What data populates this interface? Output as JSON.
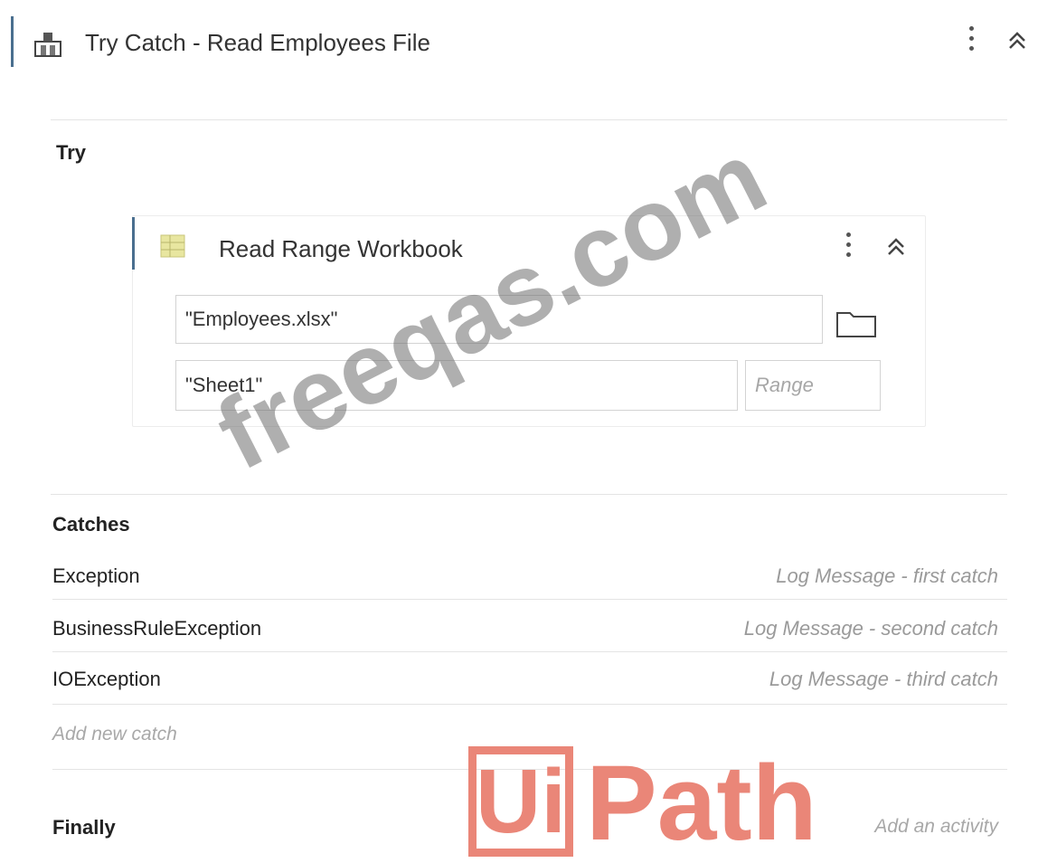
{
  "header": {
    "title": "Try Catch - Read Employees File",
    "icon": "try-catch-icon"
  },
  "try": {
    "label": "Try",
    "activity": {
      "title": "Read Range Workbook",
      "icon": "excel-workbook-icon",
      "workbook_path": "\"Employees.xlsx\"",
      "sheet_name": "\"Sheet1\"",
      "range_placeholder": "Range",
      "browse_icon": "folder-icon"
    }
  },
  "catches": {
    "label": "Catches",
    "items": [
      {
        "type": "Exception",
        "action": "Log Message - first catch"
      },
      {
        "type": "BusinessRuleException",
        "action": "Log Message - second catch"
      },
      {
        "type": "IOException",
        "action": "Log Message - third catch"
      }
    ],
    "add_label": "Add new catch"
  },
  "finally": {
    "label": "Finally",
    "add_activity": "Add an activity"
  },
  "overlays": {
    "watermark": "freeqas.com",
    "logo_ui": "Ui",
    "logo_path": "Path"
  },
  "colors": {
    "accent_bar": "#4a6f8f",
    "logo": "#ea8678",
    "watermark": "#6e6e6e"
  }
}
